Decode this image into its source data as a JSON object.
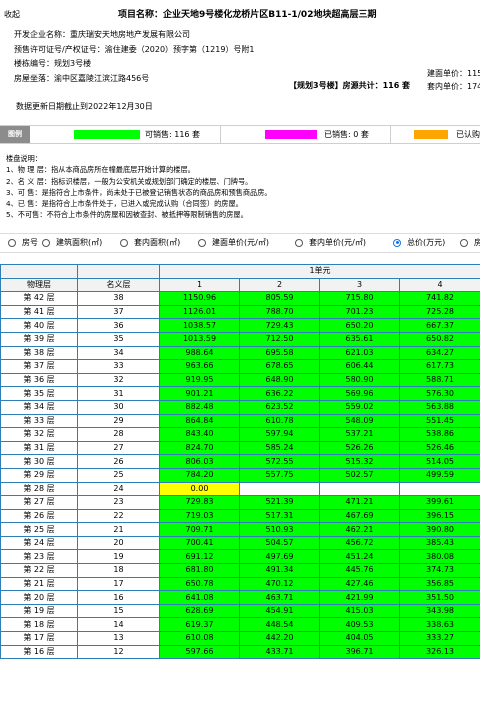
{
  "header": {
    "collapse_label": "收起"
  },
  "project": {
    "title": "项目名称：企业天地9号楼化龙桥片区B11-1/02地块超高层三期",
    "developer": "开发企业名称：重庆瑞安天地房地产发展有限公司",
    "permit": "预售许可证号/产权证号：渝住建委（2020）预字第（1219）号附1",
    "building_no": "楼栋编号：规划3号楼",
    "address": "房屋坐落：渝中区嘉陵江滨江路456号",
    "stats": "【规划3号楼】房源共计：116 套",
    "side_area": "建面单价：115",
    "side_inner": "套内单价：174",
    "update_date": "数据更新日期截止到2022年12月30日"
  },
  "legend": {
    "head": "图例",
    "items": [
      {
        "label": "可销售: 116 套",
        "color": "#00ff00"
      },
      {
        "label": "已销售: 0 套",
        "color": "#ff00ff"
      },
      {
        "label": "已认购",
        "color": "#ffa500"
      }
    ]
  },
  "notes": [
    "楼盘说明：",
    "1、物 理 层：指从本商品房所在幢最底层开始计算的楼层。",
    "2、名 义 层：指标识楼层，一般为公安机关或规划部门确定的楼层、门牌号。",
    "3、可 售：是指符合上市条件，尚未处于已被登记销售状态的商品房和预售商品房。",
    "4、已 售：是指符合上市条件处于，已进入或完成认购（合同签）的房屋。",
    "5、不可售：不符合上市条件的房屋和因被查封、被抵押等限制销售的房屋。"
  ],
  "radio_options": [
    {
      "label": "房号",
      "checked": false
    },
    {
      "label": "建筑面积(㎡)",
      "checked": false
    },
    {
      "label": "套内面积(㎡)",
      "checked": false
    },
    {
      "label": "建面单价(元/㎡)",
      "checked": false
    },
    {
      "label": "套内单价(元/㎡)",
      "checked": false
    },
    {
      "label": "总价(万元)",
      "checked": true
    },
    {
      "label": "房",
      "checked": false
    }
  ],
  "colors": {
    "available": "#00ff00",
    "subscribed": "#ffff00",
    "border": "#2e7fb8"
  },
  "table": {
    "unit_label": "1单元",
    "col_floor": "物理层",
    "col_name": "名义层",
    "units": [
      "1",
      "2",
      "3",
      "4"
    ],
    "rows": [
      {
        "floor": "第 42 层",
        "name": "38",
        "cells": [
          {
            "v": "1150.96",
            "s": "g"
          },
          {
            "v": "805.59",
            "s": "g"
          },
          {
            "v": "715.80",
            "s": "g"
          },
          {
            "v": "741.82",
            "s": "g"
          }
        ]
      },
      {
        "floor": "第 41 层",
        "name": "37",
        "cells": [
          {
            "v": "1126.01",
            "s": "g"
          },
          {
            "v": "788.70",
            "s": "g"
          },
          {
            "v": "701.23",
            "s": "g"
          },
          {
            "v": "725.28",
            "s": "g"
          }
        ]
      },
      {
        "floor": "第 40 层",
        "name": "36",
        "cells": [
          {
            "v": "1038.57",
            "s": "g"
          },
          {
            "v": "729.43",
            "s": "g"
          },
          {
            "v": "650.20",
            "s": "g"
          },
          {
            "v": "667.37",
            "s": "g"
          }
        ]
      },
      {
        "floor": "第 39 层",
        "name": "35",
        "cells": [
          {
            "v": "1013.59",
            "s": "g"
          },
          {
            "v": "712.50",
            "s": "g"
          },
          {
            "v": "635.61",
            "s": "g"
          },
          {
            "v": "650.82",
            "s": "g"
          }
        ]
      },
      {
        "floor": "第 38 层",
        "name": "34",
        "cells": [
          {
            "v": "988.64",
            "s": "g"
          },
          {
            "v": "695.58",
            "s": "g"
          },
          {
            "v": "621.03",
            "s": "g"
          },
          {
            "v": "634.27",
            "s": "g"
          }
        ]
      },
      {
        "floor": "第 37 层",
        "name": "33",
        "cells": [
          {
            "v": "963.66",
            "s": "g"
          },
          {
            "v": "678.65",
            "s": "g"
          },
          {
            "v": "606.44",
            "s": "g"
          },
          {
            "v": "617.73",
            "s": "g"
          }
        ]
      },
      {
        "floor": "第 36 层",
        "name": "32",
        "cells": [
          {
            "v": "919.95",
            "s": "g"
          },
          {
            "v": "648.90",
            "s": "g"
          },
          {
            "v": "580.90",
            "s": "g"
          },
          {
            "v": "588.71",
            "s": "g"
          }
        ]
      },
      {
        "floor": "第 35 层",
        "name": "31",
        "cells": [
          {
            "v": "901.21",
            "s": "g"
          },
          {
            "v": "636.22",
            "s": "g"
          },
          {
            "v": "569.96",
            "s": "g"
          },
          {
            "v": "576.30",
            "s": "g"
          }
        ]
      },
      {
        "floor": "第 34 层",
        "name": "30",
        "cells": [
          {
            "v": "882.48",
            "s": "g"
          },
          {
            "v": "623.52",
            "s": "g"
          },
          {
            "v": "559.02",
            "s": "g"
          },
          {
            "v": "563.88",
            "s": "g"
          }
        ]
      },
      {
        "floor": "第 33 层",
        "name": "29",
        "cells": [
          {
            "v": "864.84",
            "s": "g"
          },
          {
            "v": "610.78",
            "s": "g"
          },
          {
            "v": "548.09",
            "s": "g"
          },
          {
            "v": "551.45",
            "s": "g"
          }
        ]
      },
      {
        "floor": "第 32 层",
        "name": "28",
        "cells": [
          {
            "v": "843.40",
            "s": "g"
          },
          {
            "v": "597.94",
            "s": "g"
          },
          {
            "v": "537.21",
            "s": "g"
          },
          {
            "v": "538.86",
            "s": "g"
          }
        ]
      },
      {
        "floor": "第 31 层",
        "name": "27",
        "cells": [
          {
            "v": "824.70",
            "s": "g"
          },
          {
            "v": "585.24",
            "s": "g"
          },
          {
            "v": "526.26",
            "s": "g"
          },
          {
            "v": "526.46",
            "s": "g"
          }
        ]
      },
      {
        "floor": "第 30 层",
        "name": "26",
        "cells": [
          {
            "v": "806.03",
            "s": "g"
          },
          {
            "v": "572.55",
            "s": "g"
          },
          {
            "v": "515.32",
            "s": "g"
          },
          {
            "v": "514.05",
            "s": "g"
          }
        ]
      },
      {
        "floor": "第 29 层",
        "name": "25",
        "cells": [
          {
            "v": "784.20",
            "s": "g"
          },
          {
            "v": "557.75",
            "s": "g"
          },
          {
            "v": "502.57",
            "s": "g"
          },
          {
            "v": "499.59",
            "s": "g"
          }
        ]
      },
      {
        "floor": "第 28 层",
        "name": "24",
        "cells": [
          {
            "v": "0.00",
            "s": "y"
          },
          {
            "v": "",
            "s": "e"
          },
          {
            "v": "",
            "s": "e"
          },
          {
            "v": "",
            "s": "e"
          }
        ]
      },
      {
        "floor": "第 27 层",
        "name": "23",
        "cells": [
          {
            "v": "729.83",
            "s": "g"
          },
          {
            "v": "521.39",
            "s": "g"
          },
          {
            "v": "471.21",
            "s": "g"
          },
          {
            "v": "399.61",
            "s": "g"
          }
        ]
      },
      {
        "floor": "第 26 层",
        "name": "22",
        "cells": [
          {
            "v": "719.03",
            "s": "g"
          },
          {
            "v": "517.31",
            "s": "g"
          },
          {
            "v": "467.69",
            "s": "g"
          },
          {
            "v": "396.15",
            "s": "g"
          }
        ]
      },
      {
        "floor": "第 25 层",
        "name": "21",
        "cells": [
          {
            "v": "709.71",
            "s": "g"
          },
          {
            "v": "510.93",
            "s": "g"
          },
          {
            "v": "462.21",
            "s": "g"
          },
          {
            "v": "390.80",
            "s": "g"
          }
        ]
      },
      {
        "floor": "第 24 层",
        "name": "20",
        "cells": [
          {
            "v": "700.41",
            "s": "g"
          },
          {
            "v": "504.57",
            "s": "g"
          },
          {
            "v": "456.72",
            "s": "g"
          },
          {
            "v": "385.43",
            "s": "g"
          }
        ]
      },
      {
        "floor": "第 23 层",
        "name": "19",
        "cells": [
          {
            "v": "691.12",
            "s": "g"
          },
          {
            "v": "497.69",
            "s": "g"
          },
          {
            "v": "451.24",
            "s": "g"
          },
          {
            "v": "380.08",
            "s": "g"
          }
        ]
      },
      {
        "floor": "第 22 层",
        "name": "18",
        "cells": [
          {
            "v": "681.80",
            "s": "g"
          },
          {
            "v": "491.34",
            "s": "g"
          },
          {
            "v": "445.76",
            "s": "g"
          },
          {
            "v": "374.73",
            "s": "g"
          }
        ]
      },
      {
        "floor": "第 21 层",
        "name": "17",
        "cells": [
          {
            "v": "650.78",
            "s": "g"
          },
          {
            "v": "470.12",
            "s": "g"
          },
          {
            "v": "427.46",
            "s": "g"
          },
          {
            "v": "356.85",
            "s": "g"
          }
        ]
      },
      {
        "floor": "第 20 层",
        "name": "16",
        "cells": [
          {
            "v": "641.08",
            "s": "g"
          },
          {
            "v": "463.71",
            "s": "g"
          },
          {
            "v": "421.99",
            "s": "g"
          },
          {
            "v": "351.50",
            "s": "g"
          }
        ]
      },
      {
        "floor": "第 19 层",
        "name": "15",
        "cells": [
          {
            "v": "628.69",
            "s": "g"
          },
          {
            "v": "454.91",
            "s": "g"
          },
          {
            "v": "415.03",
            "s": "g"
          },
          {
            "v": "343.98",
            "s": "g"
          }
        ]
      },
      {
        "floor": "第 18 层",
        "name": "14",
        "cells": [
          {
            "v": "619.37",
            "s": "g"
          },
          {
            "v": "448.54",
            "s": "g"
          },
          {
            "v": "409.53",
            "s": "g"
          },
          {
            "v": "338.63",
            "s": "g"
          }
        ]
      },
      {
        "floor": "第 17 层",
        "name": "13",
        "cells": [
          {
            "v": "610.08",
            "s": "g"
          },
          {
            "v": "442.20",
            "s": "g"
          },
          {
            "v": "404.05",
            "s": "g"
          },
          {
            "v": "333.27",
            "s": "g"
          }
        ]
      },
      {
        "floor": "第 16 层",
        "name": "12",
        "cells": [
          {
            "v": "597.66",
            "s": "g"
          },
          {
            "v": "433.71",
            "s": "g"
          },
          {
            "v": "396.71",
            "s": "g"
          },
          {
            "v": "326.13",
            "s": "g"
          }
        ]
      }
    ]
  }
}
